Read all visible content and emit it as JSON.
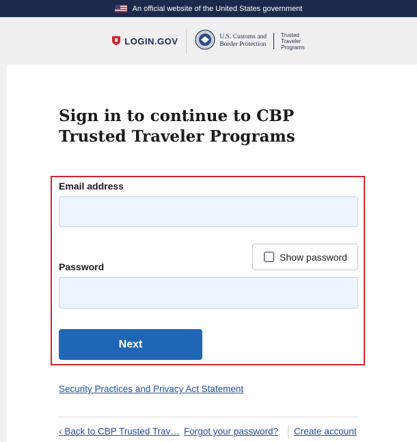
{
  "banner": {
    "text": "An official website of the United States government",
    "flag_icon": "us-flag-icon"
  },
  "header": {
    "login_logo_text": "LOGIN.GOV",
    "agency_line1": "U.S. Customs and",
    "agency_line2": "Border Protection",
    "program_line1": "Trusted",
    "program_line2": "Traveler",
    "program_line3": "Programs"
  },
  "page": {
    "title": "Sign in to continue to CBP Trusted Traveler Programs"
  },
  "form": {
    "email_label": "Email address",
    "email_value": "",
    "password_label": "Password",
    "password_value": "",
    "show_password_label": "Show password",
    "show_password_checked": false,
    "next_label": "Next"
  },
  "links": {
    "security": "Security Practices and Privacy Act Statement",
    "back": "‹ Back to CBP Trusted Trav…",
    "forgot": "Forgot your password?",
    "create": "Create account"
  },
  "colors": {
    "banner_bg": "#1b2a4a",
    "primary": "#1f67b5",
    "highlight_border": "#d4232c",
    "link": "#1f4fa0"
  }
}
